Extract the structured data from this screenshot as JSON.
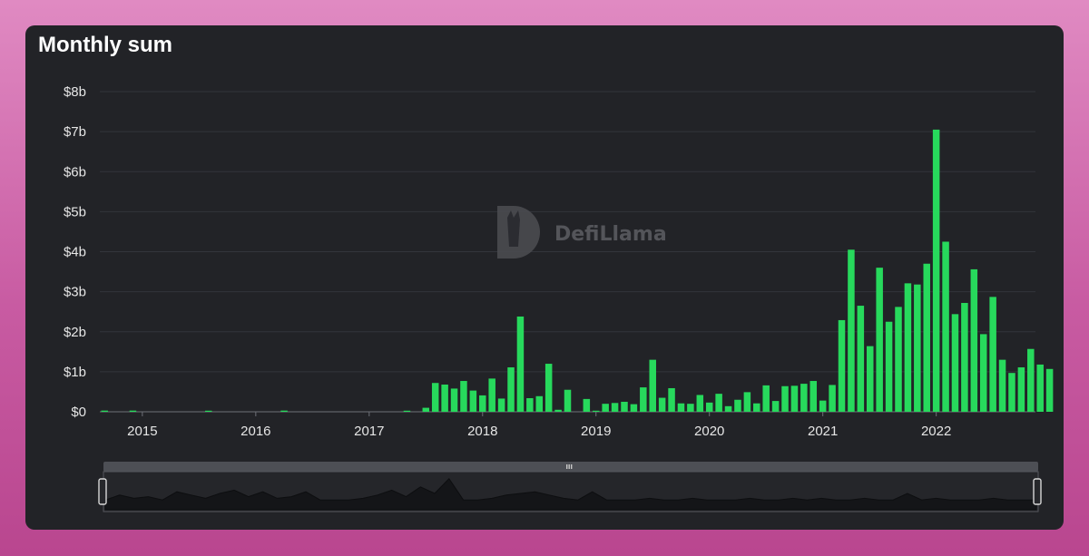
{
  "title": "Monthly sum",
  "watermark": "DefiLlama",
  "colors": {
    "background": "#222327",
    "bar": "#27d95c",
    "grid": "#33353b",
    "text": "#e6e6e6"
  },
  "chart_data": {
    "type": "bar",
    "title": "Monthly sum",
    "xlabel": "",
    "ylabel": "",
    "y_unit": "billion USD",
    "ylim": [
      0,
      8
    ],
    "y_ticks": [
      "$0",
      "$1b",
      "$2b",
      "$3b",
      "$4b",
      "$5b",
      "$6b",
      "$7b",
      "$8b"
    ],
    "x_ticks": [
      "2015",
      "2016",
      "2017",
      "2018",
      "2019",
      "2020",
      "2021",
      "2022"
    ],
    "grid": true,
    "legend": "none",
    "categories": [
      "2014-09",
      "2014-10",
      "2014-11",
      "2014-12",
      "2015-01",
      "2015-02",
      "2015-03",
      "2015-04",
      "2015-05",
      "2015-06",
      "2015-07",
      "2015-08",
      "2015-09",
      "2015-10",
      "2015-11",
      "2015-12",
      "2016-01",
      "2016-02",
      "2016-03",
      "2016-04",
      "2016-05",
      "2016-06",
      "2016-07",
      "2016-08",
      "2016-09",
      "2016-10",
      "2016-11",
      "2016-12",
      "2017-01",
      "2017-02",
      "2017-03",
      "2017-04",
      "2017-05",
      "2017-06",
      "2017-07",
      "2017-08",
      "2017-09",
      "2017-10",
      "2017-11",
      "2017-12",
      "2018-01",
      "2018-02",
      "2018-03",
      "2018-04",
      "2018-05",
      "2018-06",
      "2018-07",
      "2018-08",
      "2018-09",
      "2018-10",
      "2018-11",
      "2018-12",
      "2019-01",
      "2019-02",
      "2019-03",
      "2019-04",
      "2019-05",
      "2019-06",
      "2019-07",
      "2019-08",
      "2019-09",
      "2019-10",
      "2019-11",
      "2019-12",
      "2020-01",
      "2020-02",
      "2020-03",
      "2020-04",
      "2020-05",
      "2020-06",
      "2020-07",
      "2020-08",
      "2020-09",
      "2020-10",
      "2020-11",
      "2020-12",
      "2021-01",
      "2021-02",
      "2021-03",
      "2021-04",
      "2021-05",
      "2021-06",
      "2021-07",
      "2021-08",
      "2021-09",
      "2021-10",
      "2021-11",
      "2021-12",
      "2022-01",
      "2022-02",
      "2022-03",
      "2022-04",
      "2022-05",
      "2022-06",
      "2022-07",
      "2022-08",
      "2022-09",
      "2022-10",
      "2022-11"
    ],
    "values": [
      0.03,
      0,
      0,
      0.03,
      0,
      0,
      0,
      0,
      0,
      0,
      0,
      0.02,
      0,
      0,
      0,
      0,
      0,
      0,
      0,
      0.03,
      0,
      0,
      0,
      0,
      0,
      0,
      0,
      0,
      0,
      0,
      0,
      0,
      0.02,
      0,
      0.1,
      0.72,
      0.68,
      0.58,
      0.77,
      0.53,
      0.41,
      0.83,
      0.33,
      1.11,
      2.38,
      0.34,
      0.39,
      1.2,
      0.05,
      0.55,
      0,
      0.32,
      0.02,
      0.2,
      0.22,
      0.25,
      0.19,
      0.61,
      1.3,
      0.35,
      0.59,
      0.21,
      0.2,
      0.42,
      0.23,
      0.45,
      0.14,
      0.3,
      0.49,
      0.21,
      0.66,
      0.27,
      0.64,
      0.65,
      0.7,
      0.77,
      0.28,
      0.67,
      2.29,
      4.05,
      2.65,
      1.64,
      3.6,
      2.25,
      2.62,
      3.21,
      3.18,
      3.7,
      7.05,
      4.25,
      2.44,
      2.72,
      3.56,
      1.94,
      2.87,
      1.3,
      0.97,
      1.11,
      1.57,
      1.18,
      1.07
    ]
  }
}
